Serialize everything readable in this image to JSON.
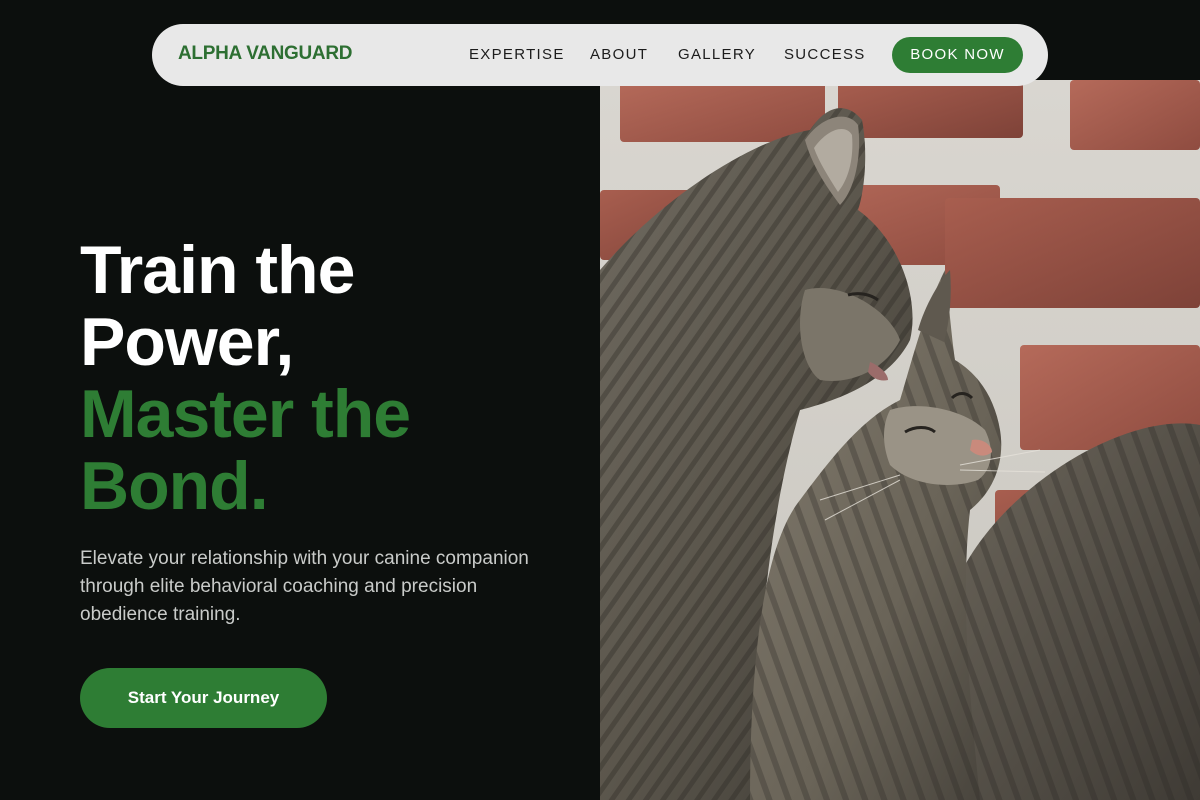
{
  "nav": {
    "brand": "ALPHA VANGUARD",
    "links": [
      "EXPERTISE",
      "ABOUT",
      "GALLERY",
      "SUCCESS"
    ],
    "cta": "BOOK NOW"
  },
  "hero": {
    "headline_white": [
      "Train the",
      "Power,"
    ],
    "headline_green": [
      "Master the",
      "Bond."
    ],
    "subtext": "Elevate your relationship with your canine companion through elite behavioral coaching and precision obedience training.",
    "cta": "Start Your Journey"
  },
  "colors": {
    "background": "#0c0f0d",
    "accent": "#2e7d34",
    "nav_background": "#e8e8e8"
  }
}
